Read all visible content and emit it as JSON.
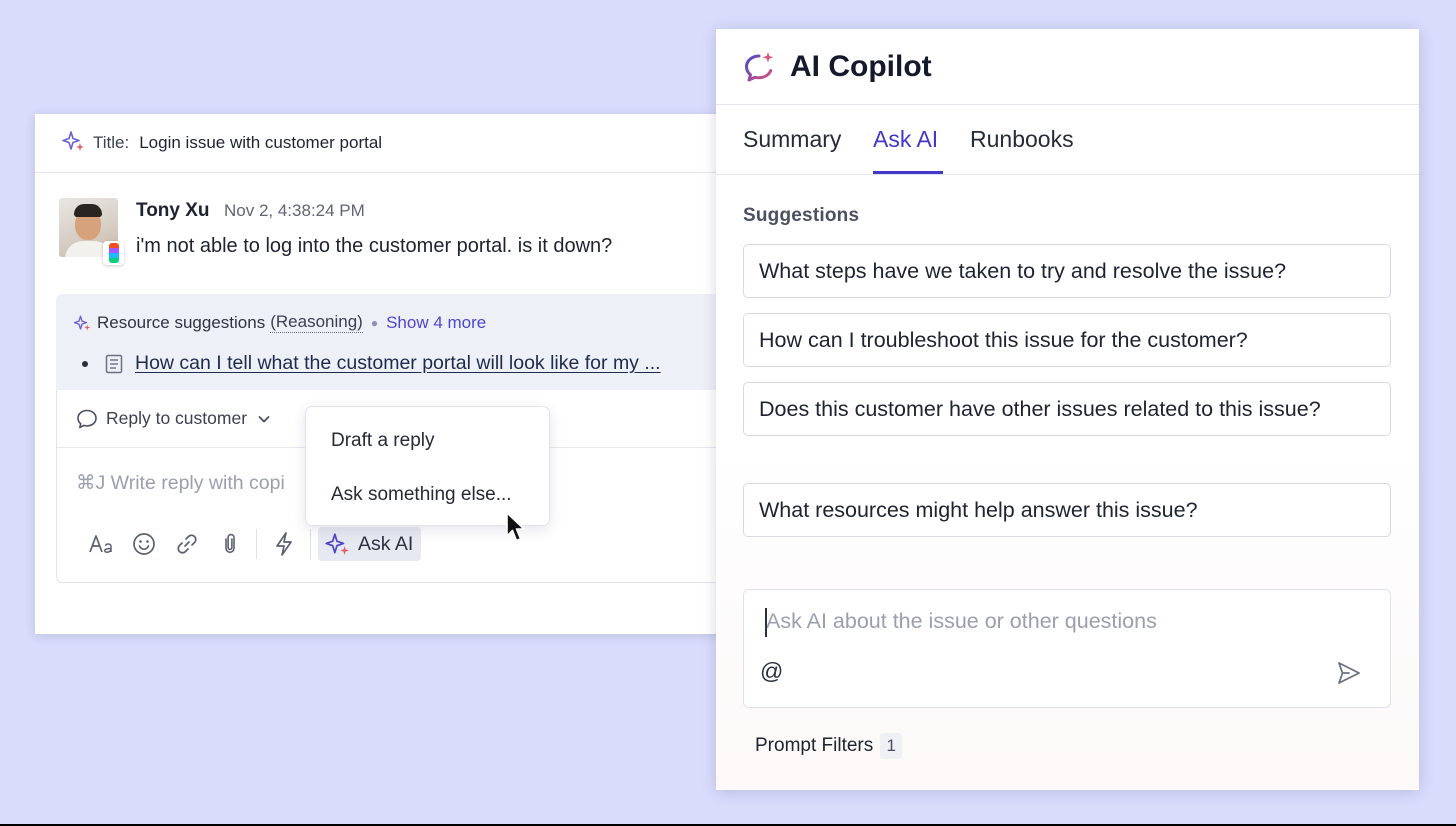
{
  "ticket": {
    "title_label": "Title:",
    "title_value": "Login issue with customer portal",
    "message": {
      "author": "Tony Xu",
      "timestamp": "Nov 2, 4:38:24 PM",
      "text": "i'm not able to log into the customer portal. is it down?"
    },
    "resources": {
      "heading": "Resource suggestions",
      "reasoning": "(Reasoning)",
      "show_more": "Show 4 more",
      "items": [
        {
          "label": "How can I tell what the customer portal will look like for my ..."
        }
      ]
    },
    "composer": {
      "reply_mode": "Reply to customer",
      "placeholder": "⌘J Write reply with copi",
      "ask_ai_label": "Ask AI"
    },
    "menu": {
      "items": [
        "Draft a reply",
        "Ask something else..."
      ]
    }
  },
  "copilot": {
    "title": "AI Copilot",
    "tabs": [
      "Summary",
      "Ask AI",
      "Runbooks"
    ],
    "active_tab": "Ask AI",
    "suggestions_label": "Suggestions",
    "suggestions": [
      "What steps have we taken to try and resolve the issue?",
      "How can I troubleshoot this issue for the customer?",
      "Does this customer have other issues related to this issue?",
      "What resources might help answer this issue?"
    ],
    "ask_placeholder": "Ask AI about the issue or other questions",
    "mention_symbol": "@",
    "prompt_filters_label": "Prompt Filters",
    "prompt_filters_count": "1"
  },
  "colors": {
    "background": "#d9dcfb",
    "accent": "#4338ca",
    "link": "#4f46c9"
  }
}
